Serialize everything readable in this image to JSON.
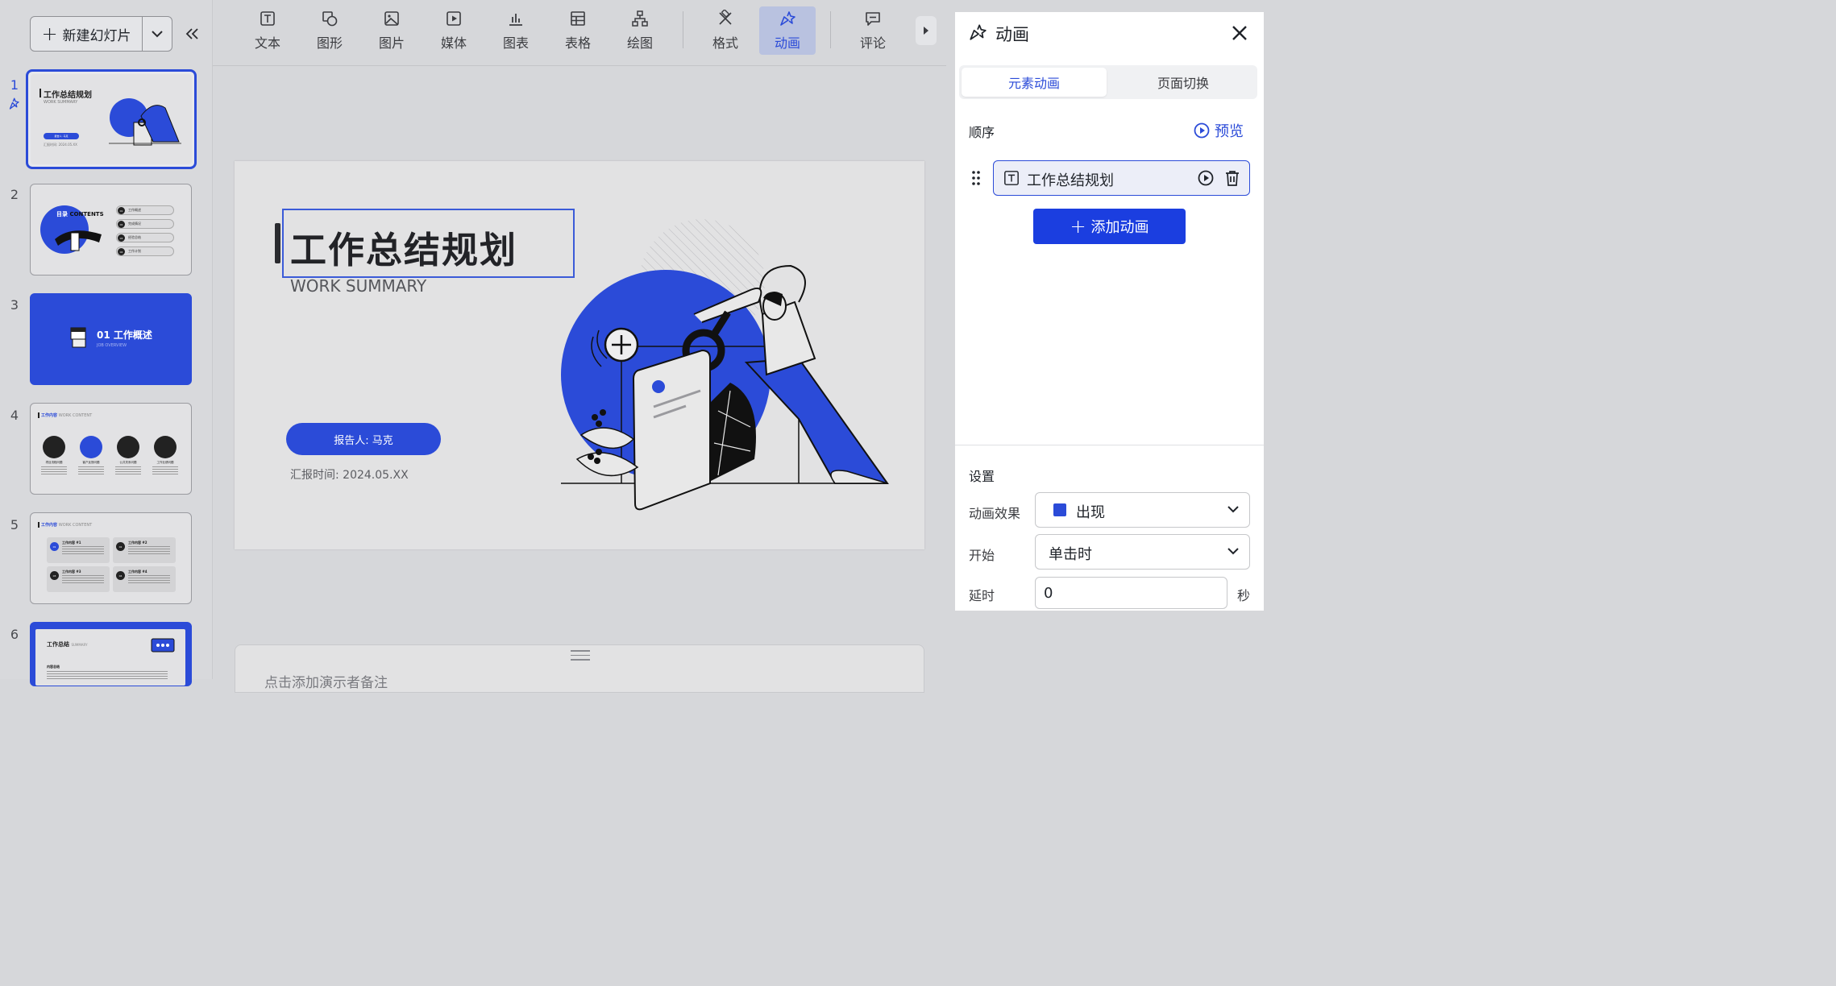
{
  "sidebar": {
    "new_slide_label": "新建幻灯片",
    "slides": [
      {
        "num": "1",
        "title": "工作总结规划",
        "subtitle": "WORK SUMMARY",
        "reporter": "报告人: 马克",
        "date": "汇报时间: 2024.05.XX"
      },
      {
        "num": "2",
        "title": "目录",
        "title_en": "CONTENTS",
        "items": [
          "工作概述",
          "完成情况",
          "经验总结",
          "工作计划"
        ],
        "item_nums": [
          "01",
          "02",
          "03",
          "04"
        ]
      },
      {
        "num": "3",
        "title": "01 工作概述",
        "subtitle": "JOB OVERVIEW"
      },
      {
        "num": "4",
        "title": "工作内容",
        "title_en": "WORK CONTENT",
        "items": [
          "项目流程问题",
          "客户反馈问题",
          "公共关系问题",
          "工作业绩问题"
        ]
      },
      {
        "num": "5",
        "title": "工作内容",
        "title_en": "WORK CONTENT",
        "items": [
          "工作内容 #1",
          "工作内容 #2",
          "工作内容 #3",
          "工作内容 #4"
        ],
        "item_nums": [
          "01",
          "02",
          "03",
          "04"
        ]
      },
      {
        "num": "6",
        "title": "工作总结",
        "title_en": "SUMMARY",
        "body_title": "内容总结"
      }
    ]
  },
  "toolbar": {
    "items": [
      {
        "label": "文本",
        "icon": "text-icon"
      },
      {
        "label": "图形",
        "icon": "shape-icon"
      },
      {
        "label": "图片",
        "icon": "image-icon"
      },
      {
        "label": "媒体",
        "icon": "media-icon"
      },
      {
        "label": "图表",
        "icon": "chart-icon"
      },
      {
        "label": "表格",
        "icon": "table-icon"
      },
      {
        "label": "绘图",
        "icon": "diagram-icon"
      },
      {
        "label": "格式",
        "icon": "format-icon"
      },
      {
        "label": "动画",
        "icon": "animation-icon",
        "active": true
      },
      {
        "label": "评论",
        "icon": "comment-icon"
      }
    ]
  },
  "slide": {
    "title": "工作总结规划",
    "subtitle": "WORK SUMMARY",
    "reporter": "报告人: 马克",
    "date": "汇报时间:  2024.05.XX"
  },
  "notes": {
    "placeholder": "点击添加演示者备注"
  },
  "panel": {
    "title": "动画",
    "tabs": [
      "元素动画",
      "页面切换"
    ],
    "active_tab": "元素动画",
    "order_label": "顺序",
    "preview_label": "预览",
    "anim_items": [
      {
        "label": "工作总结规划",
        "type": "text"
      }
    ],
    "add_label": "添加动画",
    "settings_label": "设置",
    "effect_label": "动画效果",
    "effect_value": "出现",
    "start_label": "开始",
    "start_value": "单击时",
    "delay_label": "延时",
    "delay_value": "0",
    "delay_unit": "秒"
  },
  "colors": {
    "accent": "#2b4bd8",
    "button_primary": "#1b3ee0",
    "canvas_bg": "#d6d7da",
    "slide_bg": "#e2e2e3"
  }
}
